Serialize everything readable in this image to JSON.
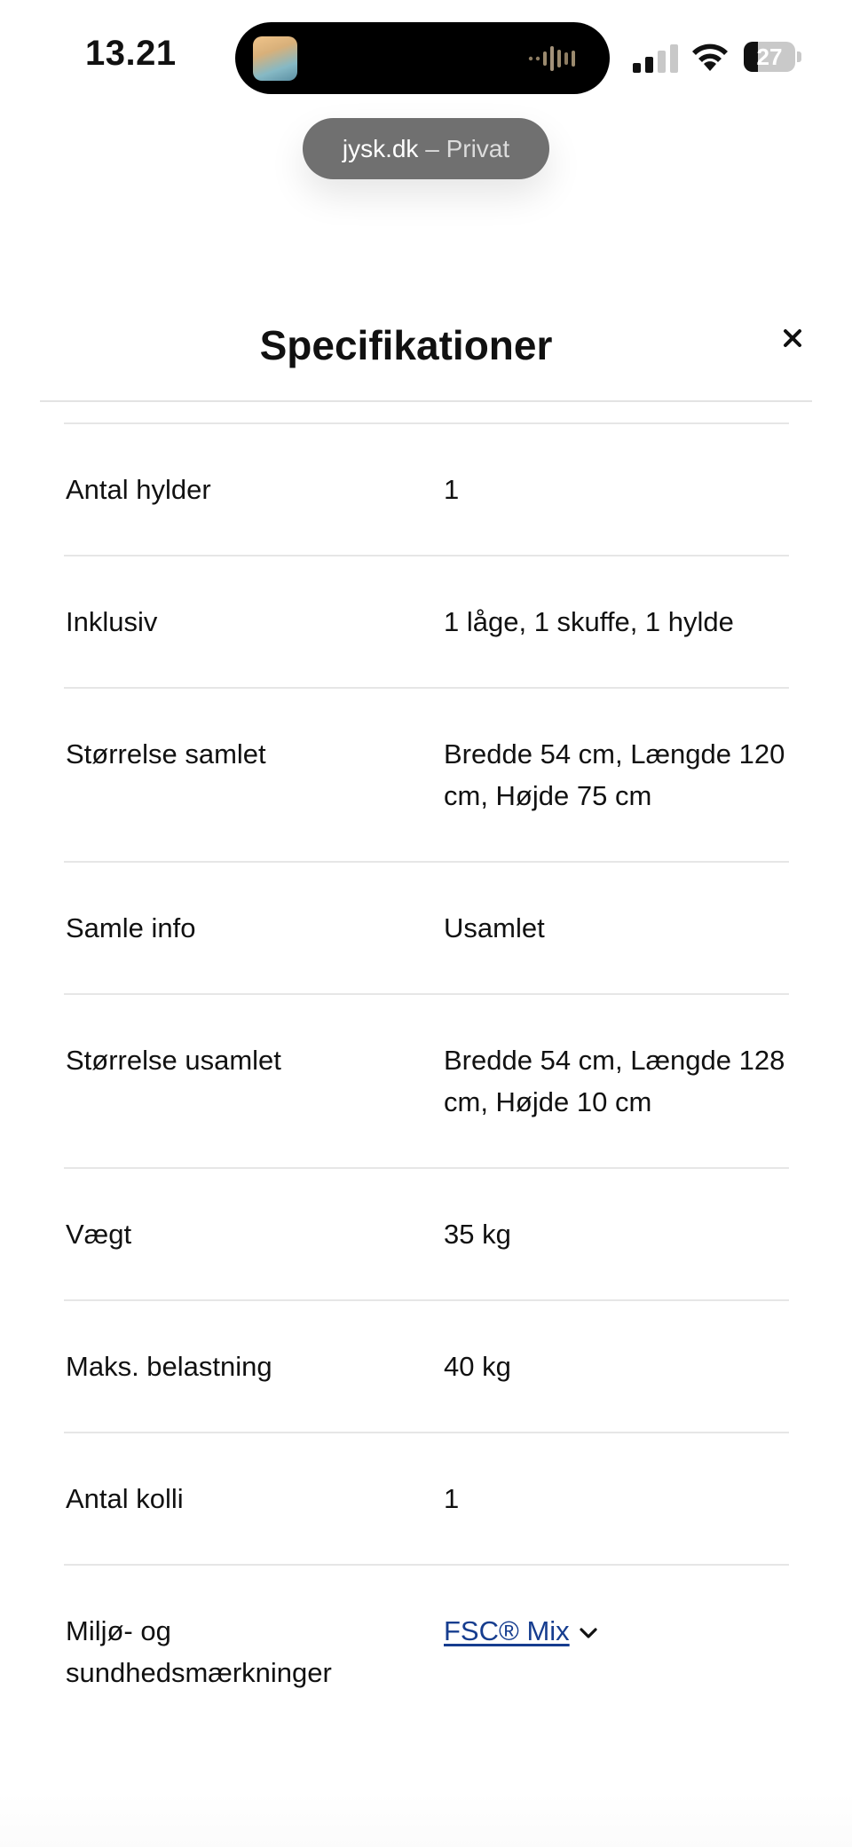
{
  "status_bar": {
    "time": "13.21",
    "battery_level": "27",
    "battery_fraction": 0.27,
    "icons": [
      "now-playing-thumbnail",
      "audio-waveform-icon",
      "cellular-signal-icon",
      "wifi-icon",
      "battery-icon"
    ]
  },
  "browser": {
    "domain": "jysk.dk",
    "separator": "–",
    "mode": "Privat"
  },
  "modal": {
    "title": "Specifikationer",
    "close_icon": "close-icon"
  },
  "specs": [
    {
      "label": "Antal hylder",
      "value": "1"
    },
    {
      "label": "Inklusiv",
      "value": "1 låge, 1 skuffe, 1 hylde"
    },
    {
      "label": "Størrelse samlet",
      "value": "Bredde 54 cm, Længde 120 cm, Højde 75 cm"
    },
    {
      "label": "Samle info",
      "value": "Usamlet"
    },
    {
      "label": "Størrelse usamlet",
      "value": "Bredde 54 cm, Længde 128 cm, Højde 10 cm"
    },
    {
      "label": "Vægt",
      "value": "35 kg"
    },
    {
      "label": "Maks. belastning",
      "value": "40 kg"
    },
    {
      "label": "Antal kolli",
      "value": "1"
    },
    {
      "label": "Miljø- og sundhedsmærkninger",
      "value": "FSC® Mix",
      "is_link": true,
      "link_color": "#163d8f"
    }
  ]
}
